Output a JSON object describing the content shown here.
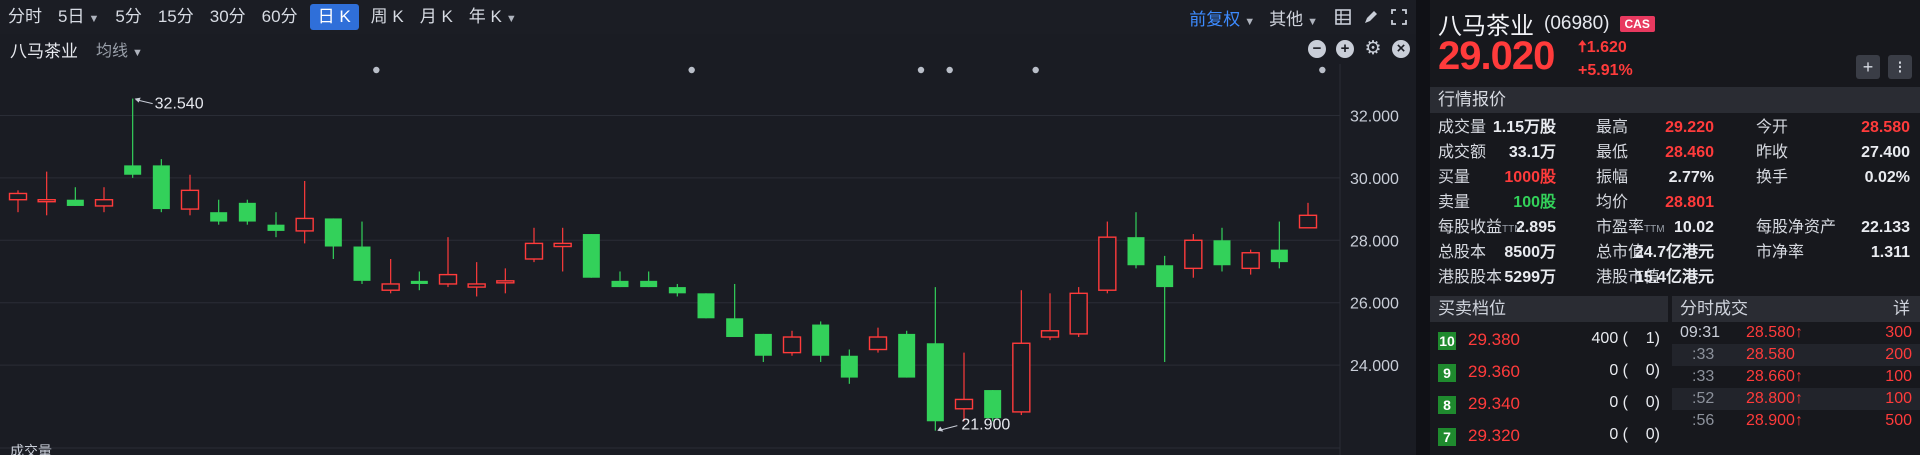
{
  "toolbar": {
    "periods": [
      {
        "label": "分时",
        "caret": false
      },
      {
        "label": "5日",
        "caret": true
      },
      {
        "label": "5分",
        "caret": false
      },
      {
        "label": "15分",
        "caret": false
      },
      {
        "label": "30分",
        "caret": false
      },
      {
        "label": "60分",
        "caret": false
      },
      {
        "label": "日 K",
        "caret": false,
        "active": true
      },
      {
        "label": "周 K",
        "caret": false
      },
      {
        "label": "月 K",
        "caret": false
      },
      {
        "label": "年 K",
        "caret": true
      }
    ],
    "adjust_label": "前复权",
    "other_label": "其他",
    "accent": "#2f6fd9"
  },
  "subbar": {
    "stock_name": "八马茶业",
    "ma_label": "均线",
    "icons": [
      "minus-icon",
      "plus-icon",
      "gear-icon",
      "close-icon"
    ]
  },
  "chart_data": {
    "type": "candlestick",
    "y_ticks": [
      "32.000",
      "30.000",
      "28.000",
      "26.000",
      "24.000"
    ],
    "ylim": [
      21.6,
      33.2
    ],
    "max_annotation": "32.540",
    "min_annotation": "21.900",
    "up_color": "#ff3b3b",
    "down_color": "#33d15a",
    "candles": [
      {
        "o": 29.3,
        "h": 29.6,
        "l": 28.9,
        "c": 29.5
      },
      {
        "o": 29.3,
        "h": 30.2,
        "l": 28.8,
        "c": 29.3
      },
      {
        "o": 29.3,
        "h": 29.7,
        "l": 29.1,
        "c": 29.1
      },
      {
        "o": 29.1,
        "h": 29.7,
        "l": 28.9,
        "c": 29.3
      },
      {
        "o": 30.4,
        "h": 32.54,
        "l": 30.0,
        "c": 30.1
      },
      {
        "o": 30.4,
        "h": 30.6,
        "l": 28.9,
        "c": 29.0
      },
      {
        "o": 29.0,
        "h": 30.1,
        "l": 28.8,
        "c": 29.6
      },
      {
        "o": 28.9,
        "h": 29.3,
        "l": 28.5,
        "c": 28.6
      },
      {
        "o": 29.2,
        "h": 29.3,
        "l": 28.5,
        "c": 28.6
      },
      {
        "o": 28.5,
        "h": 28.9,
        "l": 28.1,
        "c": 28.3
      },
      {
        "o": 28.3,
        "h": 29.9,
        "l": 27.9,
        "c": 28.7
      },
      {
        "o": 28.7,
        "h": 28.7,
        "l": 27.4,
        "c": 27.8
      },
      {
        "o": 27.8,
        "h": 28.6,
        "l": 26.6,
        "c": 26.7
      },
      {
        "o": 26.4,
        "h": 27.4,
        "l": 26.3,
        "c": 26.6
      },
      {
        "o": 26.7,
        "h": 27.0,
        "l": 26.4,
        "c": 26.6
      },
      {
        "o": 26.6,
        "h": 28.1,
        "l": 26.5,
        "c": 26.9
      },
      {
        "o": 26.5,
        "h": 27.3,
        "l": 26.2,
        "c": 26.6
      },
      {
        "o": 26.7,
        "h": 27.1,
        "l": 26.3,
        "c": 26.7
      },
      {
        "o": 27.4,
        "h": 28.4,
        "l": 27.3,
        "c": 27.9
      },
      {
        "o": 27.8,
        "h": 28.4,
        "l": 27.0,
        "c": 27.9
      },
      {
        "o": 28.2,
        "h": 28.2,
        "l": 26.8,
        "c": 26.8
      },
      {
        "o": 26.7,
        "h": 27.0,
        "l": 26.5,
        "c": 26.5
      },
      {
        "o": 26.7,
        "h": 27.0,
        "l": 26.5,
        "c": 26.5
      },
      {
        "o": 26.5,
        "h": 26.6,
        "l": 26.2,
        "c": 26.3
      },
      {
        "o": 26.3,
        "h": 26.3,
        "l": 25.5,
        "c": 25.5
      },
      {
        "o": 25.5,
        "h": 26.6,
        "l": 24.9,
        "c": 24.9
      },
      {
        "o": 25.0,
        "h": 25.0,
        "l": 24.1,
        "c": 24.3
      },
      {
        "o": 24.4,
        "h": 25.1,
        "l": 24.3,
        "c": 24.9
      },
      {
        "o": 25.3,
        "h": 25.4,
        "l": 24.1,
        "c": 24.3
      },
      {
        "o": 24.3,
        "h": 24.5,
        "l": 23.4,
        "c": 23.6
      },
      {
        "o": 24.5,
        "h": 25.2,
        "l": 24.4,
        "c": 24.9
      },
      {
        "o": 25.0,
        "h": 25.1,
        "l": 23.6,
        "c": 23.6
      },
      {
        "o": 24.7,
        "h": 26.5,
        "l": 21.9,
        "c": 22.2
      },
      {
        "o": 22.6,
        "h": 24.4,
        "l": 22.2,
        "c": 22.9
      },
      {
        "o": 23.2,
        "h": 23.2,
        "l": 22.2,
        "c": 22.3
      },
      {
        "o": 22.5,
        "h": 26.4,
        "l": 22.4,
        "c": 24.7
      },
      {
        "o": 24.9,
        "h": 26.3,
        "l": 24.8,
        "c": 25.1
      },
      {
        "o": 25.0,
        "h": 26.5,
        "l": 24.9,
        "c": 26.3
      },
      {
        "o": 26.4,
        "h": 28.6,
        "l": 26.3,
        "c": 28.1
      },
      {
        "o": 28.1,
        "h": 28.9,
        "l": 27.1,
        "c": 27.2
      },
      {
        "o": 27.2,
        "h": 27.5,
        "l": 24.1,
        "c": 26.5
      },
      {
        "o": 27.1,
        "h": 28.2,
        "l": 26.8,
        "c": 28.0
      },
      {
        "o": 28.0,
        "h": 28.4,
        "l": 27.0,
        "c": 27.2
      },
      {
        "o": 27.1,
        "h": 27.7,
        "l": 26.9,
        "c": 27.6
      },
      {
        "o": 27.7,
        "h": 28.6,
        "l": 27.1,
        "c": 27.3
      },
      {
        "o": 28.4,
        "h": 29.2,
        "l": 28.4,
        "c": 28.8
      }
    ],
    "event_markers": [
      12,
      23,
      31,
      32,
      35,
      45
    ],
    "volume_label": "成交量"
  },
  "panel": {
    "name": "八马茶业",
    "code": "(06980)",
    "badge": "CAS",
    "price": "29.020",
    "change": "1.620",
    "change_pct": "+5.91%",
    "quote_header": "行情报价",
    "quote_rows": [
      [
        {
          "l": "成交量",
          "v": "1.15万股",
          "c": ""
        },
        {
          "l": "最高",
          "v": "29.220",
          "c": "red"
        },
        {
          "l": "今开",
          "v": "28.580",
          "c": "red"
        }
      ],
      [
        {
          "l": "成交额",
          "v": "33.1万",
          "c": ""
        },
        {
          "l": "最低",
          "v": "28.460",
          "c": "red"
        },
        {
          "l": "昨收",
          "v": "27.400",
          "c": ""
        }
      ],
      [
        {
          "l": "买量",
          "v": "1000股",
          "c": "red"
        },
        {
          "l": "振幅",
          "v": "2.77%",
          "c": ""
        },
        {
          "l": "换手",
          "v": "0.02%",
          "c": ""
        }
      ],
      [
        {
          "l": "卖量",
          "v": "100股",
          "c": "green"
        },
        {
          "l": "均价",
          "v": "28.801",
          "c": "red"
        },
        {
          "l": "",
          "v": "",
          "c": ""
        }
      ],
      [
        {
          "l": "每股收益",
          "ttm": "TTM",
          "v": "2.895",
          "c": ""
        },
        {
          "l": "市盈率",
          "ttm": "TTM",
          "v": "10.02",
          "c": ""
        },
        {
          "l": "每股净资产",
          "v": "22.133",
          "c": ""
        }
      ],
      [
        {
          "l": "总股本",
          "v": "8500万",
          "c": ""
        },
        {
          "l": "总市值",
          "v": "24.7亿港元",
          "c": ""
        },
        {
          "l": "市净率",
          "v": "1.311",
          "c": ""
        }
      ],
      [
        {
          "l": "港股股本",
          "v": "5299万",
          "c": ""
        },
        {
          "l": "港股市值",
          "v": "15.4亿港元",
          "c": ""
        },
        {
          "l": "",
          "v": "",
          "c": ""
        }
      ]
    ],
    "book_header": "买卖档位",
    "book": [
      {
        "level": "10",
        "price": "29.380",
        "qty": "400 (    1)"
      },
      {
        "level": "9",
        "price": "29.360",
        "qty": "0 (    0)"
      },
      {
        "level": "8",
        "price": "29.340",
        "qty": "0 (    0)"
      },
      {
        "level": "7",
        "price": "29.320",
        "qty": "0 (    0)"
      }
    ],
    "ticks_header": "分时成交",
    "ticks_detail": "详",
    "ticks": [
      {
        "time": "09:31",
        "price": "28.580↑",
        "vol": "300"
      },
      {
        "time": ":33",
        "price": "28.580",
        "vol": "200"
      },
      {
        "time": ":33",
        "price": "28.660↑",
        "vol": "100"
      },
      {
        "time": ":52",
        "price": "28.800↑",
        "vol": "100"
      },
      {
        "time": ":56",
        "price": "28.900↑",
        "vol": "500"
      }
    ]
  }
}
